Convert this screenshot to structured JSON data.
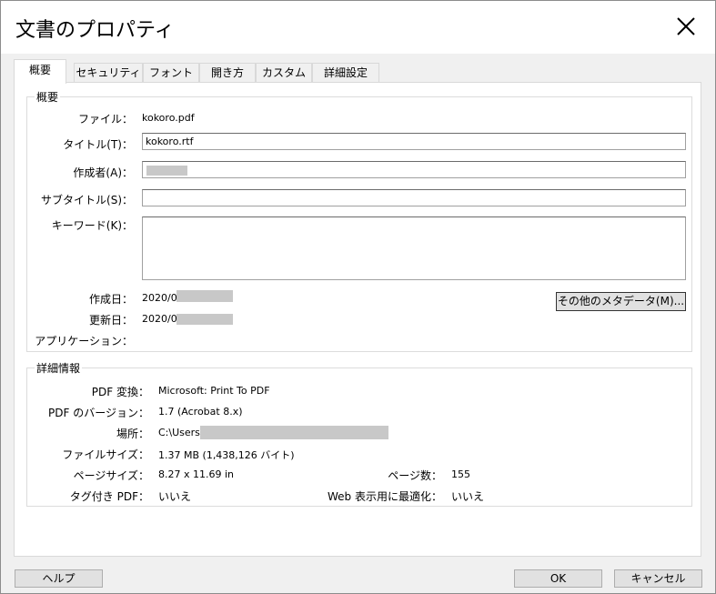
{
  "window": {
    "title": "文書のプロパティ"
  },
  "tabs": [
    {
      "label": "概要"
    },
    {
      "label": "セキュリティ"
    },
    {
      "label": "フォント"
    },
    {
      "label": "開き方"
    },
    {
      "label": "カスタム"
    },
    {
      "label": "詳細設定"
    }
  ],
  "summary": {
    "group_label": "概要",
    "file_label": "ファイル：",
    "file_value": "kokoro.pdf",
    "title_label": "タイトル(T)：",
    "title_value": "kokoro.rtf",
    "author_label": "作成者(A)：",
    "author_value": "",
    "subtitle_label": "サブタイトル(S)：",
    "subtitle_value": "",
    "keywords_label": "キーワード(K)：",
    "keywords_value": "",
    "created_label": "作成日：",
    "created_value": "2020/0",
    "modified_label": "更新日：",
    "modified_value": "2020/0",
    "application_label": "アプリケーション：",
    "application_value": "",
    "metadata_button": "その他のメタデータ(M)..."
  },
  "details": {
    "group_label": "詳細情報",
    "pdf_producer_label": "PDF 変換：",
    "pdf_producer_value": "Microsoft: Print To PDF",
    "pdf_version_label": "PDF のバージョン：",
    "pdf_version_value": "1.7 (Acrobat 8.x)",
    "location_label": "場所：",
    "location_value": "C:\\Users\\",
    "file_size_label": "ファイルサイズ：",
    "file_size_value": "1.37 MB (1,438,126 バイト)",
    "page_size_label": "ページサイズ：",
    "page_size_value": "8.27 x 11.69 in",
    "page_count_label": "ページ数：",
    "page_count_value": "155",
    "tagged_label": "タグ付き PDF：",
    "tagged_value": "いいえ",
    "fast_web_label": "Web 表示用に最適化：",
    "fast_web_value": "いいえ"
  },
  "footer": {
    "help_button": "ヘルプ",
    "ok_button": "OK",
    "cancel_button": "キャンセル"
  },
  "colors": {
    "dialog_bg": "#f0f0f0",
    "panel_bg": "#ffffff",
    "redaction": "#c8c8c8"
  },
  "icons": {
    "close": "close-icon"
  }
}
